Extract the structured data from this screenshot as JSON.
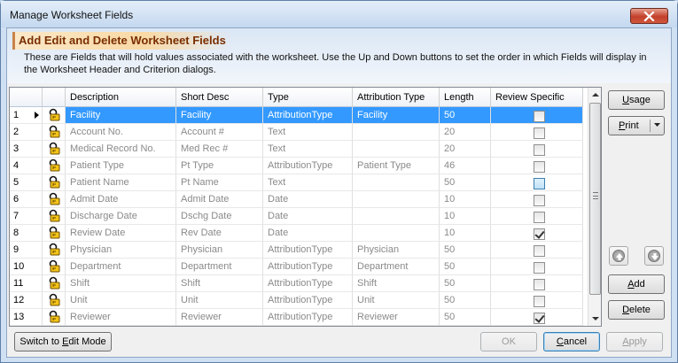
{
  "window": {
    "title": "Manage Worksheet Fields"
  },
  "header": {
    "title": "Add Edit and Delete Worksheet Fields",
    "description": "These are Fields that will hold values associated with the worksheet. Use the Up and Down buttons to set the order in which Fields will display in the Worksheet Header and Criterion dialogs."
  },
  "grid": {
    "columns": [
      "Description",
      "Short Desc",
      "Type",
      "Attribution Type",
      "Length",
      "Review Specific"
    ],
    "rows": [
      {
        "num": "1",
        "description": "Facility",
        "short": "Facility",
        "type": "AttributionType",
        "attribution": "Facility",
        "length": "50",
        "review_specific": false,
        "selected": true
      },
      {
        "num": "2",
        "description": "Account No.",
        "short": "Account #",
        "type": "Text",
        "attribution": "",
        "length": "20",
        "review_specific": false
      },
      {
        "num": "3",
        "description": "Medical Record No.",
        "short": "Med Rec #",
        "type": "Text",
        "attribution": "",
        "length": "20",
        "review_specific": false
      },
      {
        "num": "4",
        "description": "Patient Type",
        "short": "Pt Type",
        "type": "AttributionType",
        "attribution": "Patient Type",
        "length": "46",
        "review_specific": false
      },
      {
        "num": "5",
        "description": "Patient Name",
        "short": "Pt Name",
        "type": "Text",
        "attribution": "",
        "length": "50",
        "review_specific": false,
        "highlighted": true
      },
      {
        "num": "6",
        "description": "Admit Date",
        "short": "Admit Date",
        "type": "Date",
        "attribution": "",
        "length": "10",
        "review_specific": false
      },
      {
        "num": "7",
        "description": "Discharge Date",
        "short": "Dschg Date",
        "type": "Date",
        "attribution": "",
        "length": "10",
        "review_specific": false
      },
      {
        "num": "8",
        "description": "Review Date",
        "short": "Rev Date",
        "type": "Date",
        "attribution": "",
        "length": "10",
        "review_specific": true
      },
      {
        "num": "9",
        "description": "Physician",
        "short": "Physician",
        "type": "AttributionType",
        "attribution": "Physician",
        "length": "50",
        "review_specific": false
      },
      {
        "num": "10",
        "description": "Department",
        "short": "Department",
        "type": "AttributionType",
        "attribution": "Department",
        "length": "50",
        "review_specific": false
      },
      {
        "num": "11",
        "description": "Shift",
        "short": "Shift",
        "type": "AttributionType",
        "attribution": "Shift",
        "length": "50",
        "review_specific": false
      },
      {
        "num": "12",
        "description": "Unit",
        "short": "Unit",
        "type": "AttributionType",
        "attribution": "Unit",
        "length": "50",
        "review_specific": false
      },
      {
        "num": "13",
        "description": "Reviewer",
        "short": "Reviewer",
        "type": "AttributionType",
        "attribution": "Reviewer",
        "length": "50",
        "review_specific": true
      }
    ]
  },
  "side_buttons": {
    "usage_prefix": "",
    "usage_key": "U",
    "usage_rest": "sage",
    "print_prefix": "",
    "print_key": "P",
    "print_rest": "rint",
    "add_prefix": "",
    "add_key": "A",
    "add_rest": "dd",
    "delete_prefix": "",
    "delete_key": "D",
    "delete_rest": "elete"
  },
  "footer": {
    "switch_prefix": "Switch to ",
    "switch_key": "E",
    "switch_rest": "dit Mode",
    "ok_label": "OK",
    "cancel_key": "C",
    "cancel_rest": "ancel",
    "apply_key": "A",
    "apply_rest": "pply"
  },
  "icons": {
    "row_icon": "lock-key-icon",
    "close": "close-icon",
    "up": "move-up-icon",
    "down": "move-down-icon"
  }
}
